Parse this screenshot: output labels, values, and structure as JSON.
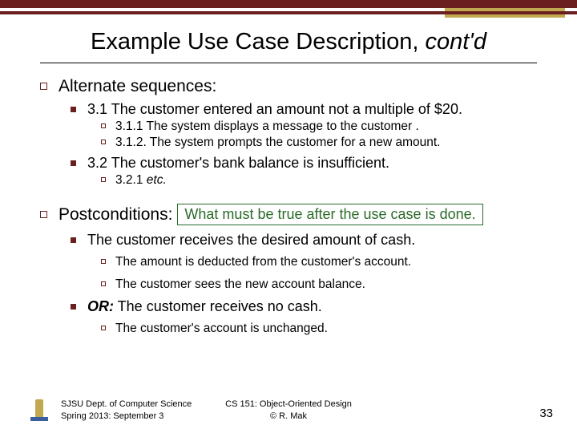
{
  "title_main": "Example Use Case Description, ",
  "title_italic": "cont'd",
  "sections": {
    "altseq_label": "Alternate sequences:",
    "s31": "3.1  The customer entered an amount not a multiple of $20.",
    "s311": "3.1.1 The system displays a message to the customer .",
    "s312": "3.1.2. The system prompts the customer for a new amount.",
    "s32": "3.2  The customer's bank balance is insufficient.",
    "s321_pre": "3.2.1 ",
    "s321_em": " etc.",
    "postcond_label": "Postconditions:",
    "postcond_box": "What must be true after the use case is done.",
    "pc1": "The customer receives the desired amount of cash.",
    "pc1a": "The amount is deducted from the customer's account.",
    "pc1b": "The customer sees the new account balance.",
    "pc2_or": "OR:",
    "pc2": " The customer receives no cash.",
    "pc2a": "The customer's account is unchanged."
  },
  "footer": {
    "left1": "SJSU Dept. of Computer Science",
    "left2": "Spring 2013: September 3",
    "center1": "CS 151: Object-Oriented Design",
    "center2": "© R. Mak",
    "page": "33"
  }
}
